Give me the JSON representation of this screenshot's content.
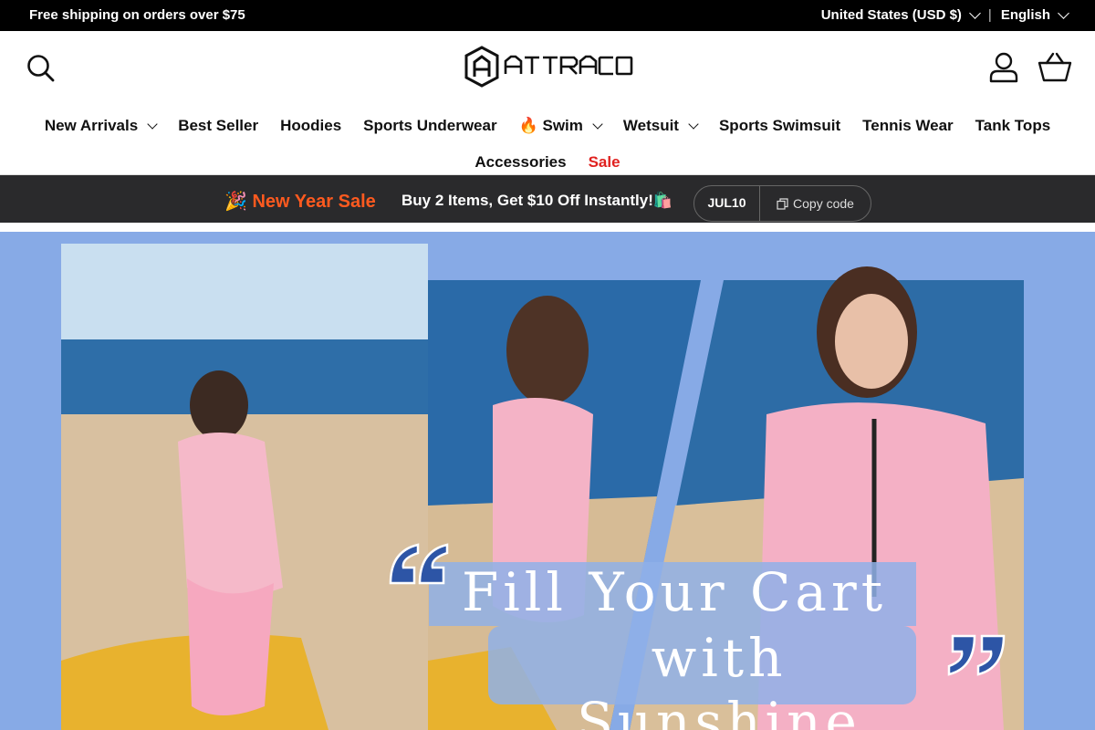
{
  "announcement": {
    "shipping": "Free shipping on orders over $75",
    "country": "United States (USD $)",
    "separator": "|",
    "language": "English"
  },
  "header": {
    "brand": "ATTRACO",
    "icons": [
      "search-icon",
      "account-icon",
      "cart-icon"
    ]
  },
  "nav": {
    "row1": [
      {
        "label": "New Arrivals",
        "dropdown": true
      },
      {
        "label": "Best Seller"
      },
      {
        "label": "Hoodies"
      },
      {
        "label": "Sports Underwear"
      },
      {
        "label": "🔥 Swim",
        "dropdown": true
      },
      {
        "label": "Wetsuit",
        "dropdown": true
      },
      {
        "label": "Sports Swimsuit"
      },
      {
        "label": "Tennis Wear"
      },
      {
        "label": "Tank Tops"
      }
    ],
    "row2": [
      {
        "label": "Accessories"
      },
      {
        "label": "Sale",
        "highlight": "#e0211f"
      }
    ]
  },
  "promo": {
    "emoji": "🎉",
    "label": "New Year Sale",
    "message": "Buy 2 Items, Get $10 Off Instantly!🛍️",
    "code": "JUL10",
    "copy_label": "Copy code"
  },
  "hero": {
    "line1": "Fill Your Cart",
    "line2": "with Sunshine",
    "background": "#87aae6"
  },
  "colors": {
    "topbar": "#000000",
    "promo_bar": "#2a2a2c",
    "promo_label": "#ff5a1f",
    "sale": "#e0211f"
  }
}
